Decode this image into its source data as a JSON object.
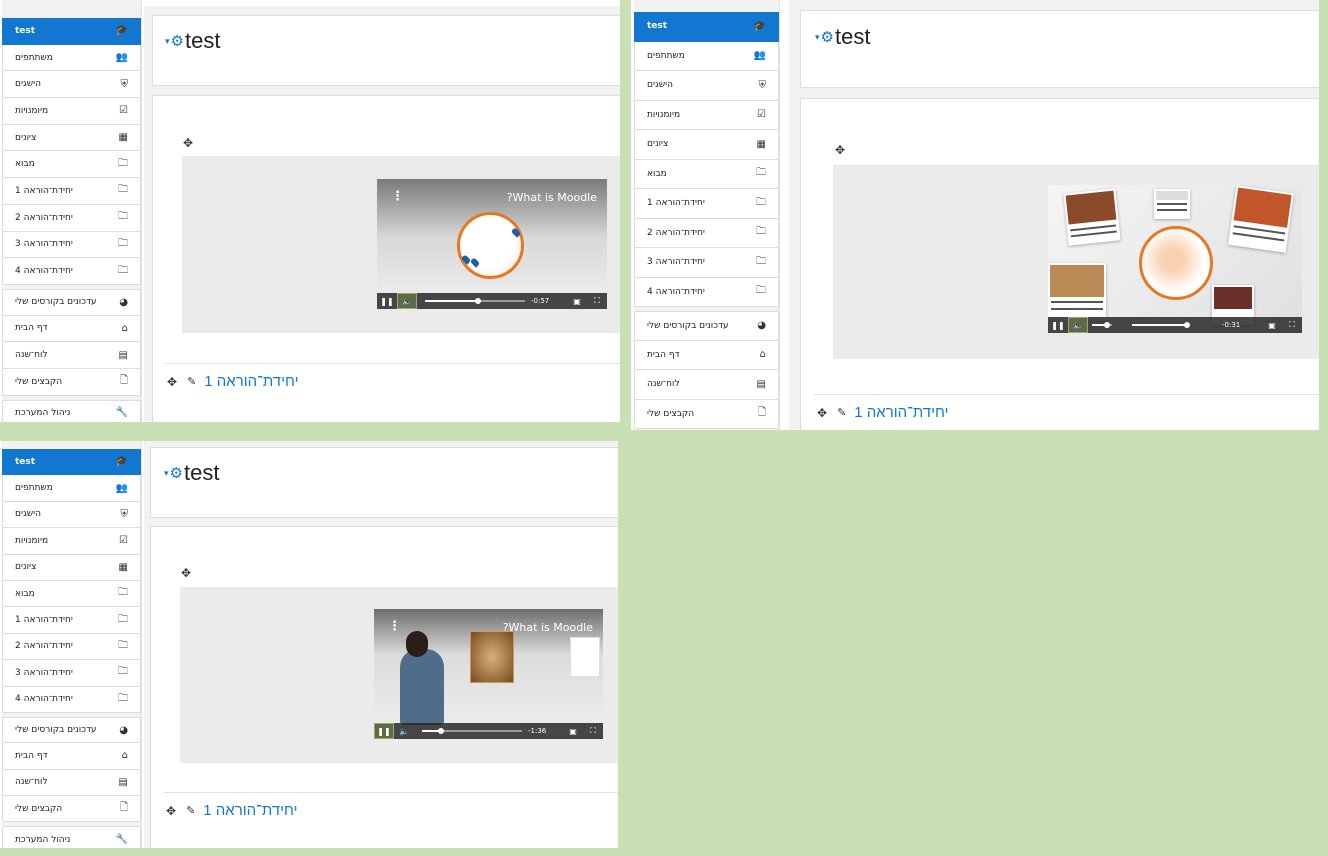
{
  "panels": [
    {
      "nav": {
        "items": [
          {
            "label": "test",
            "icon": "graduation-cap-icon",
            "glyph": "🎓"
          },
          {
            "label": "משתתפים",
            "icon": "users-icon",
            "glyph": "👥"
          },
          {
            "label": "הישגים",
            "icon": "shield-icon",
            "glyph": "⛨"
          },
          {
            "label": "מיומנויות",
            "icon": "checkbox-icon",
            "glyph": "☑"
          },
          {
            "label": "ציונים",
            "icon": "table-icon",
            "glyph": "▦"
          },
          {
            "label": "מבוא",
            "icon": "folder-icon",
            "glyph": "🗀"
          },
          {
            "label": "יחידת־הוראה 1",
            "icon": "folder-icon",
            "glyph": "🗀"
          },
          {
            "label": "יחידת־הוראה 2",
            "icon": "folder-icon",
            "glyph": "🗀"
          },
          {
            "label": "יחידת־הוראה 3",
            "icon": "folder-icon",
            "glyph": "🗀"
          },
          {
            "label": "יחידת־הוראה 4",
            "icon": "folder-icon",
            "glyph": "🗀"
          },
          {
            "label": "עדכונים בקורסים שלי",
            "icon": "dashboard-icon",
            "glyph": "◕"
          },
          {
            "label": "דף הבית",
            "icon": "home-icon",
            "glyph": "⌂"
          },
          {
            "label": "לוח־שנה",
            "icon": "calendar-icon",
            "glyph": "▤"
          },
          {
            "label": "הקבצים שלי",
            "icon": "file-icon",
            "glyph": "🗋"
          },
          {
            "label": "ניהול המערכת",
            "icon": "wrench-icon",
            "glyph": "🔧"
          }
        ]
      },
      "course_title": "test",
      "video": {
        "title": "?What is Moodle",
        "time": "-0:57",
        "scene": "globe"
      },
      "section_title": "יחידת־הוראה 1"
    },
    {
      "nav": {
        "items": [
          {
            "label": "test",
            "icon": "graduation-cap-icon",
            "glyph": "🎓"
          },
          {
            "label": "משתתפים",
            "icon": "users-icon",
            "glyph": "👥"
          },
          {
            "label": "הישגים",
            "icon": "shield-icon",
            "glyph": "⛨"
          },
          {
            "label": "מיומנויות",
            "icon": "checkbox-icon",
            "glyph": "☑"
          },
          {
            "label": "ציונים",
            "icon": "table-icon",
            "glyph": "▦"
          },
          {
            "label": "מבוא",
            "icon": "folder-icon",
            "glyph": "🗀"
          },
          {
            "label": "יחידת־הוראה 1",
            "icon": "folder-icon",
            "glyph": "🗀"
          },
          {
            "label": "יחידת־הוראה 2",
            "icon": "folder-icon",
            "glyph": "🗀"
          },
          {
            "label": "יחידת־הוראה 3",
            "icon": "folder-icon",
            "glyph": "🗀"
          },
          {
            "label": "יחידת־הוראה 4",
            "icon": "folder-icon",
            "glyph": "🗀"
          },
          {
            "label": "עדכונים בקורסים שלי",
            "icon": "dashboard-icon",
            "glyph": "◕"
          },
          {
            "label": "דף הבית",
            "icon": "home-icon",
            "glyph": "⌂"
          },
          {
            "label": "לוח־שנה",
            "icon": "calendar-icon",
            "glyph": "▤"
          },
          {
            "label": "הקבצים שלי",
            "icon": "file-icon",
            "glyph": "🗋"
          }
        ]
      },
      "course_title": "test",
      "video": {
        "title": "",
        "time": "-0:31",
        "scene": "globe-photos"
      },
      "section_title": "יחידת־הוראה 1"
    },
    {
      "nav": {
        "items": [
          {
            "label": "test",
            "icon": "graduation-cap-icon",
            "glyph": "🎓"
          },
          {
            "label": "משתתפים",
            "icon": "users-icon",
            "glyph": "👥"
          },
          {
            "label": "הישגים",
            "icon": "shield-icon",
            "glyph": "⛨"
          },
          {
            "label": "מיומנויות",
            "icon": "checkbox-icon",
            "glyph": "☑"
          },
          {
            "label": "ציונים",
            "icon": "table-icon",
            "glyph": "▦"
          },
          {
            "label": "מבוא",
            "icon": "folder-icon",
            "glyph": "🗀"
          },
          {
            "label": "יחידת־הוראה 1",
            "icon": "folder-icon",
            "glyph": "🗀"
          },
          {
            "label": "יחידת־הוראה 2",
            "icon": "folder-icon",
            "glyph": "🗀"
          },
          {
            "label": "יחידת־הוראה 3",
            "icon": "folder-icon",
            "glyph": "🗀"
          },
          {
            "label": "יחידת־הוראה 4",
            "icon": "folder-icon",
            "glyph": "🗀"
          },
          {
            "label": "עדכונים בקורסים שלי",
            "icon": "dashboard-icon",
            "glyph": "◕"
          },
          {
            "label": "דף הבית",
            "icon": "home-icon",
            "glyph": "⌂"
          },
          {
            "label": "לוח־שנה",
            "icon": "calendar-icon",
            "glyph": "▤"
          },
          {
            "label": "הקבצים שלי",
            "icon": "file-icon",
            "glyph": "🗋"
          },
          {
            "label": "ניהול המערכת",
            "icon": "wrench-icon",
            "glyph": "🔧"
          }
        ]
      },
      "course_title": "test",
      "video": {
        "title": "?What is Moodle",
        "time": "-1:36",
        "scene": "presenter"
      },
      "section_title": "יחידת־הוראה 1"
    }
  ],
  "colors": {
    "accent": "#1177d1",
    "background": "#c8e0b4",
    "globe": "#e87722"
  }
}
